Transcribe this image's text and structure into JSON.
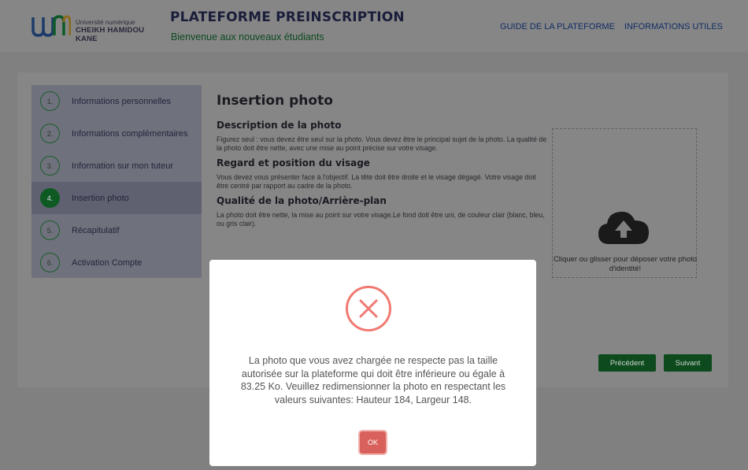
{
  "header": {
    "logo_small": "Université numérique",
    "logo_big": "CHEIKH HAMIDOU KANE",
    "title": "PLATEFORME PREINSCRIPTION",
    "subtitle": "Bienvenue aux nouveaux étudiants",
    "nav": [
      "GUIDE DE LA PLATEFORME",
      "INFORMATIONS UTILES"
    ]
  },
  "steps": [
    {
      "num": "1.",
      "label": "Informations personnelles"
    },
    {
      "num": "2.",
      "label": "Informations complémentaires"
    },
    {
      "num": "3.",
      "label": "Information sur mon tuteur"
    },
    {
      "num": "4.",
      "label": "Insertion photo"
    },
    {
      "num": "5.",
      "label": "Récapitulatif"
    },
    {
      "num": "6.",
      "label": "Activation Compte"
    }
  ],
  "active_step": 4,
  "content": {
    "title": "Insertion photo",
    "sections": [
      {
        "heading": "Description de la photo",
        "text": "Figurez seul : vous devez être seul sur la photo. Vous devez être le principal sujet de la photo. La qualité de la photo doit être nette, avec une mise au point précise sur votre visage."
      },
      {
        "heading": "Regard et position du visage",
        "text": "Vous devez vous présenter face à l'objectif. La tête doit être droite et le visage dégagé. Votre visage doit être centré par rapport au cadre de la photo."
      },
      {
        "heading": "Qualité de la photo/Arrière-plan",
        "text": "La photo doit être nette, la mise au point sur votre visage.Le fond doit être uni, de couleur clair (blanc, bleu, ou gris clair)."
      }
    ]
  },
  "upload": {
    "text": "Cliquer ou glisser pour déposer votre photo d'identité!"
  },
  "buttons": {
    "prev": "Précédent",
    "next": "Suivant"
  },
  "modal": {
    "message": "La photo que vous avez chargée ne respecte pas la taille autorisée sur la plateforme qui doit être inférieure ou égale à 83.25 Ko. Veuillez redimensionner la photo en respectant les valeurs suivantes: Hauteur 184, Largeur 148.",
    "ok": "OK"
  },
  "colors": {
    "accent": "#0d4a1e",
    "error": "#f07a72",
    "ok_button": "#d9615c"
  }
}
